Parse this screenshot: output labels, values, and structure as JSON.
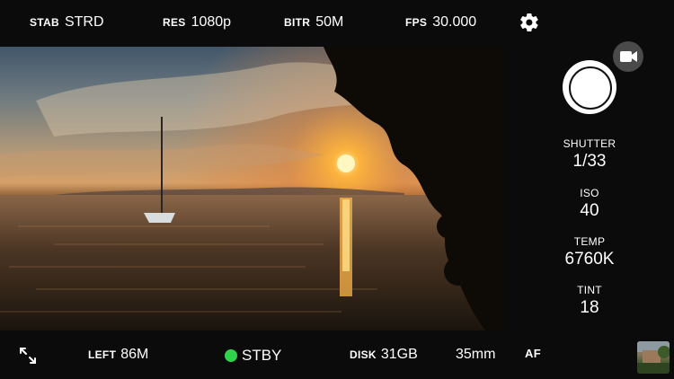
{
  "topbar": {
    "stab": {
      "label": "STAB",
      "value": "STRD"
    },
    "res": {
      "label": "RES",
      "value": "1080p"
    },
    "bitr": {
      "label": "BITR",
      "value": "50M"
    },
    "fps": {
      "label": "FPS",
      "value": "30.000"
    },
    "settings_icon": "gear-icon"
  },
  "sidebar": {
    "record_button_icon": "record-circle-icon",
    "mode_icon": "video-camera-icon",
    "params": [
      {
        "label": "SHUTTER",
        "value": "1/33"
      },
      {
        "label": "ISO",
        "value": "40"
      },
      {
        "label": "TEMP",
        "value": "6760K"
      },
      {
        "label": "TINT",
        "value": "18"
      }
    ]
  },
  "bottombar": {
    "expand_icon": "expand-icon",
    "left": {
      "label": "LEFT",
      "value": "86M"
    },
    "status": {
      "value": "STBY",
      "color": "#2fd24a"
    },
    "disk": {
      "label": "DISK",
      "value": "31GB"
    },
    "focal": "35mm",
    "focus_mode": "AF"
  }
}
